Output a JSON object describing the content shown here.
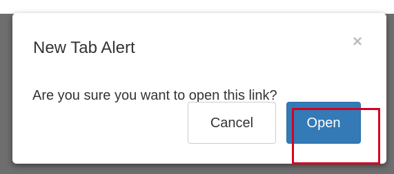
{
  "modal": {
    "title": "New Tab Alert",
    "close_glyph": "×",
    "message": "Are you sure you want to open this link?"
  },
  "buttons": {
    "cancel_label": "Cancel",
    "open_label": "Open"
  },
  "icons": {
    "close": "close-icon"
  },
  "colors": {
    "primary": "#337ab7",
    "highlight": "#d6001c",
    "overlay": "#6e6e6e"
  }
}
